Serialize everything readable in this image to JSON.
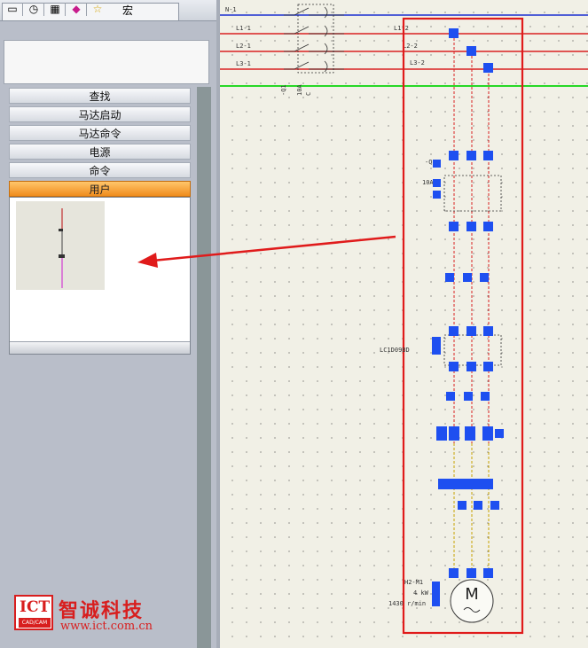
{
  "tabs": {
    "icons": [
      "layout-icon",
      "clock-icon",
      "grid-icon",
      "diamond-icon",
      "star-icon"
    ],
    "macro_label": "宏"
  },
  "accordion": {
    "items": [
      "查找",
      "马达启动",
      "马达命令",
      "电源",
      "命令"
    ],
    "active": "用户"
  },
  "logo": {
    "ict": "ICT",
    "cad": "CAD/CAM",
    "name": "智诚科技",
    "url": "www.ict.com.cn"
  },
  "colors": {
    "highlight_frame": "#e01b1b",
    "node": "#1e4ff0",
    "wire_red": "#d92020",
    "wire_blue": "#1a2fd0",
    "wire_green": "#27d827",
    "wire_yellow": "#c8a200",
    "active_tab": "#f08c1d"
  },
  "schematic": {
    "bus_labels": [
      "N-1",
      "L1-1",
      "L2-1",
      "L3-1"
    ],
    "branch_labels": [
      "L1-2",
      "L2-2",
      "L3-2"
    ],
    "breaker_labels": [
      "-Q1",
      "10A",
      "C"
    ],
    "contactor_labels": [
      "-Q1",
      "10A"
    ],
    "relay_label": "LC1D09BD",
    "motor_label": "M",
    "motor_specs": [
      "H2-M1",
      "4 kW",
      "1430 r/min"
    ]
  }
}
